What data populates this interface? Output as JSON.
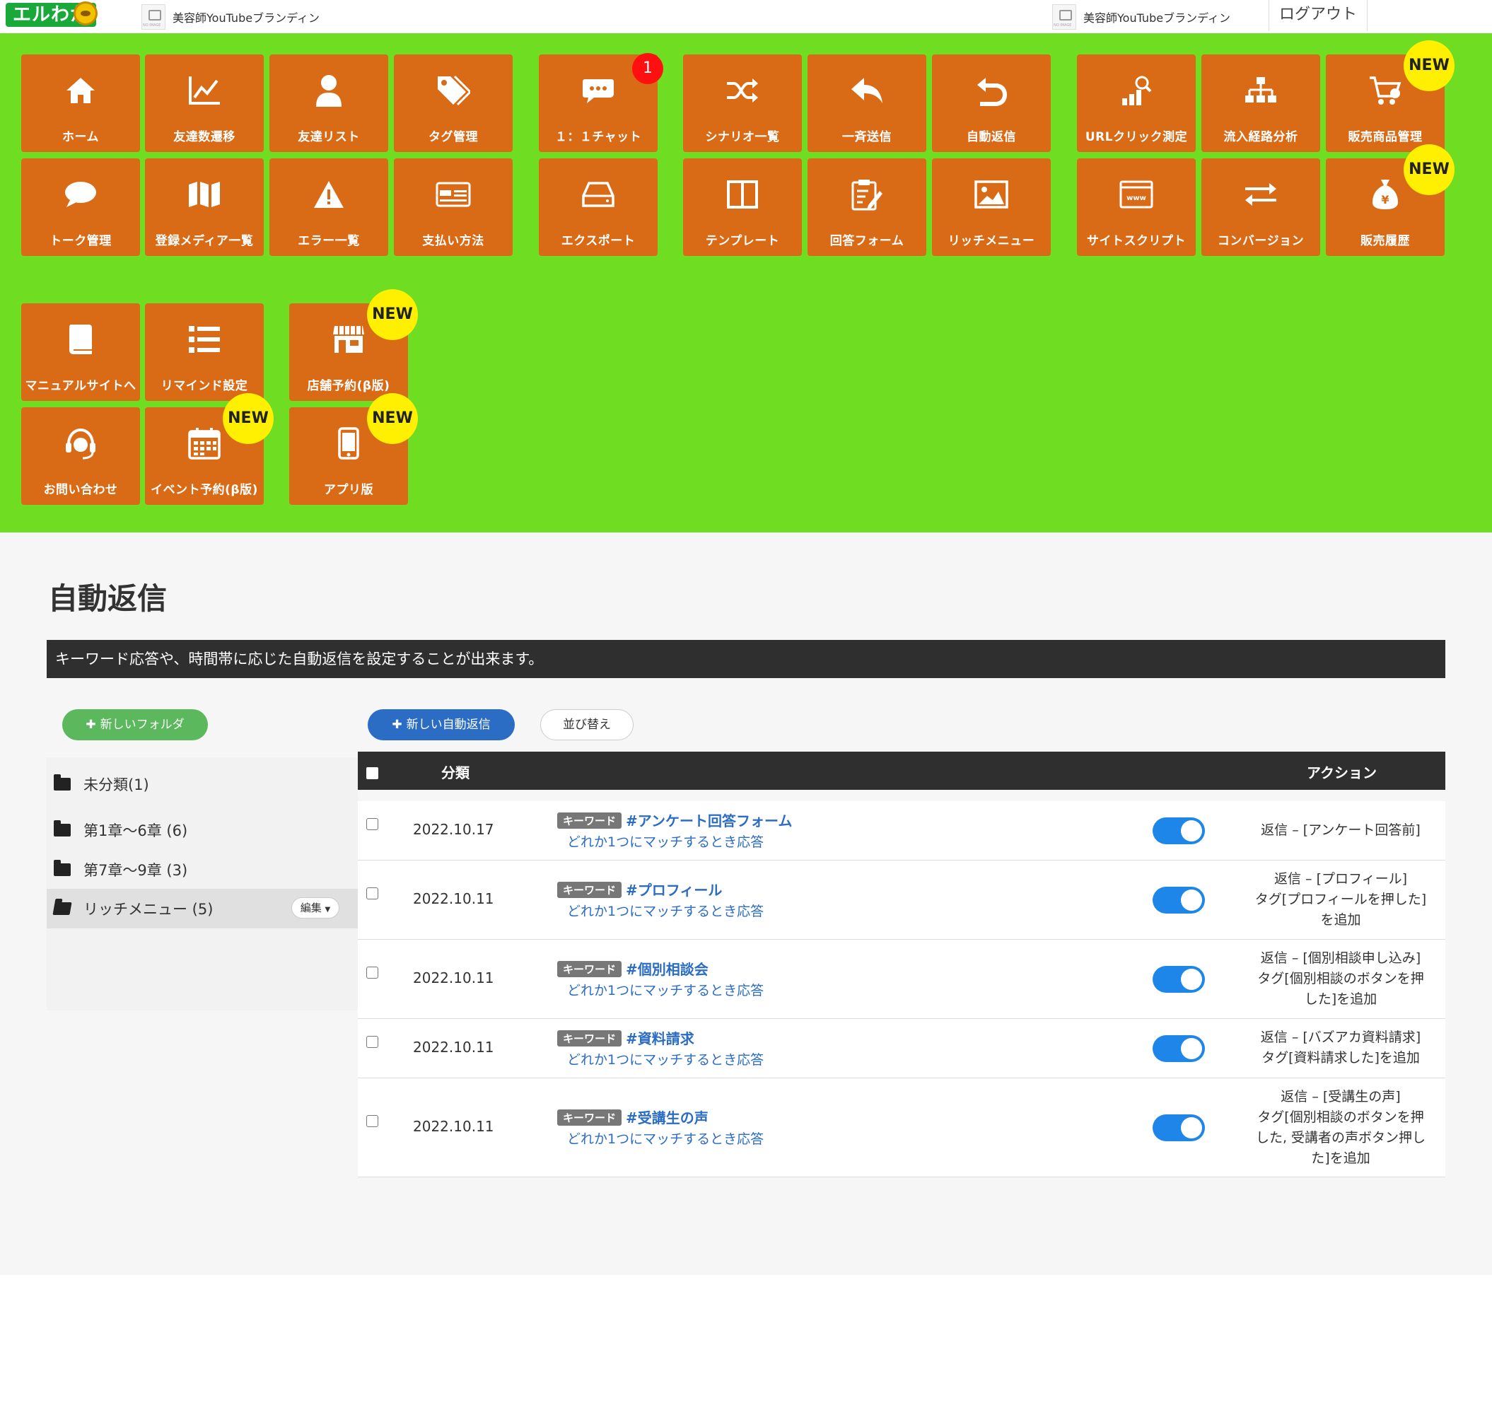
{
  "header": {
    "logo_text": "エルわか",
    "account_left": "美容師YouTubeブランディン",
    "account_right": "美容師YouTubeブランディン",
    "logout": "ログアウト"
  },
  "menu": {
    "new_badge": "NEW",
    "chat_count": "1",
    "tiles": [
      {
        "label": "ホーム",
        "icon": "home-icon"
      },
      {
        "label": "友達数遷移",
        "icon": "line-chart-icon"
      },
      {
        "label": "友達リスト",
        "icon": "user-icon"
      },
      {
        "label": "タグ管理",
        "icon": "tags-icon"
      },
      {
        "label": "１：１チャット",
        "icon": "chat-icon"
      },
      {
        "label": "シナリオ一覧",
        "icon": "shuffle-icon"
      },
      {
        "label": "一斉送信",
        "icon": "reply-icon"
      },
      {
        "label": "自動返信",
        "icon": "auto-reply-icon"
      },
      {
        "label": "URLクリック測定",
        "icon": "analytics-icon"
      },
      {
        "label": "流入経路分析",
        "icon": "sitemap-icon"
      },
      {
        "label": "販売商品管理",
        "icon": "cart-icon"
      },
      {
        "label": "トーク管理",
        "icon": "speech-bubble-icon"
      },
      {
        "label": "登録メディア一覧",
        "icon": "map-icon"
      },
      {
        "label": "エラー一覧",
        "icon": "warning-icon"
      },
      {
        "label": "支払い方法",
        "icon": "credit-card-icon"
      },
      {
        "label": "エクスポート",
        "icon": "drive-icon"
      },
      {
        "label": "テンプレート",
        "icon": "columns-icon"
      },
      {
        "label": "回答フォーム",
        "icon": "clipboard-icon"
      },
      {
        "label": "リッチメニュー",
        "icon": "image-icon"
      },
      {
        "label": "サイトスクリプト",
        "icon": "browser-icon"
      },
      {
        "label": "コンバージョン",
        "icon": "exchange-icon"
      },
      {
        "label": "販売履歴",
        "icon": "money-bag-icon"
      },
      {
        "label": "マニュアルサイトへ",
        "icon": "book-icon"
      },
      {
        "label": "リマインド設定",
        "icon": "list-icon"
      },
      {
        "label": "店舗予約(β版)",
        "icon": "store-icon"
      },
      {
        "label": "お問い合わせ",
        "icon": "headset-icon"
      },
      {
        "label": "イベント予約(β版)",
        "icon": "calendar-icon"
      },
      {
        "label": "アプリ版",
        "icon": "mobile-icon"
      }
    ]
  },
  "page": {
    "title": "自動返信",
    "description": "キーワード応答や、時間帯に応じた自動返信を設定することが出来ます。",
    "new_folder_btn": "新しいフォルダ",
    "new_reply_btn": "新しい自動返信",
    "sort_btn": "並び替え"
  },
  "folders": [
    {
      "name": "未分類(1)"
    },
    {
      "name": "第1章〜6章 (6)"
    },
    {
      "name": "第7章〜9章 (3)"
    },
    {
      "name": "リッチメニュー (5)",
      "edit": "編集"
    }
  ],
  "table": {
    "col_category": "分類",
    "col_action": "アクション",
    "keyword_tag": "キーワード",
    "match_text": "どれか1つにマッチするとき応答",
    "rows": [
      {
        "date": "2022.10.17",
        "keyword": "#アンケート回答フォーム",
        "action_lines": [
          "返信 – [アンケート回答前]"
        ],
        "enabled": true
      },
      {
        "date": "2022.10.11",
        "keyword": "#プロフィール",
        "action_lines": [
          "返信 – [プロフィール]",
          "タグ[プロフィールを押した]",
          "を追加"
        ],
        "enabled": true
      },
      {
        "date": "2022.10.11",
        "keyword": "#個別相談会",
        "action_lines": [
          "返信 – [個別相談申し込み]",
          "タグ[個別相談のボタンを押",
          "した]を追加"
        ],
        "enabled": true
      },
      {
        "date": "2022.10.11",
        "keyword": "#資料請求",
        "action_lines": [
          "返信 – [バズアカ資料請求]",
          "タグ[資料請求した]を追加"
        ],
        "enabled": true
      },
      {
        "date": "2022.10.11",
        "keyword": "#受講生の声",
        "action_lines": [
          "返信 – [受講生の声]",
          "タグ[個別相談のボタンを押",
          "した, 受講者の声ボタン押し",
          "た]を追加"
        ],
        "enabled": true
      }
    ]
  }
}
